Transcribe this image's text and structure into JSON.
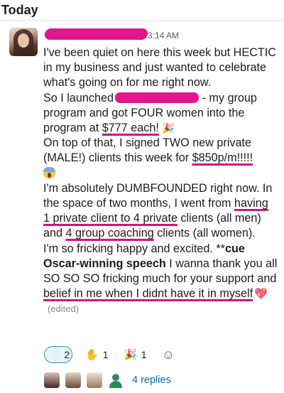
{
  "header": {
    "day": "Today"
  },
  "message": {
    "time": "3:14 AM",
    "line1": "I've been quiet on here this week but HECTIC in my business and just wanted to celebrate what's going on for me right now.",
    "line2_a": "So I launched",
    "line2_b": " - my group program and got FOUR women into the program at ",
    "line2_price": "$777 each!",
    "line3_a": "On top of that, I signed TWO new private (MALE!) clients this week for ",
    "line3_price": "$850p/m!!!!!",
    "line4_a": "I'm absolutely DUMBFOUNDED right now. In the space of two months, I went from ",
    "line4_u1": "having 1 private client to 4 private",
    "line4_b": " clients (all men) and ",
    "line4_u2": "4 group coaching",
    "line4_c": " clients (all women).",
    "line5_a": "I'm so fricking happy and excited. **",
    "line5_bold": "cue Oscar-winning speech",
    "line5_b": " I wanna thank you all SO SO SO fricking much for your support and ",
    "line5_u": "belief in me when I didnt have it in myself",
    "edited": "(edited)"
  },
  "emojis": {
    "party": "🎉",
    "heart": "💖",
    "scream": "scream-face-icon"
  },
  "reactions": [
    {
      "icon": "white-heart-icon",
      "glyph": "♡",
      "count": "2",
      "selected": true
    },
    {
      "icon": "raised-hands-icon",
      "glyph": "✋",
      "count": "1",
      "selected": false
    },
    {
      "icon": "party-popper-icon",
      "glyph": "🎉",
      "count": "1",
      "selected": false
    }
  ],
  "add_reaction_glyph": "☺",
  "thread": {
    "replies": "4 replies"
  },
  "colors": {
    "highlight": "#e0178c",
    "link": "#1264a3",
    "selected_reaction": "#1d9bd1"
  }
}
